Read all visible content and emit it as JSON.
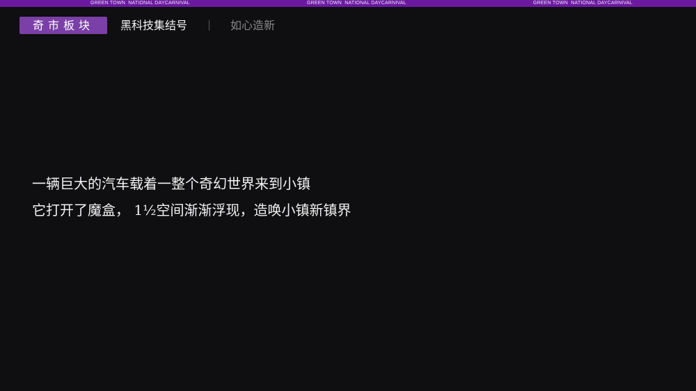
{
  "banner": {
    "texts": [
      "GREEN TOWN  NATIONAL DAYCARNIVAL",
      "GREEN TOWN  NATIONAL DAYCARNIVAL",
      "GREEN TOWN  NATIONAL DAYCARNIVAL"
    ],
    "color": "#6b1aa0"
  },
  "nav": {
    "tabs": [
      {
        "label": "奇市板块",
        "active": true
      },
      {
        "label": "黑科技集结号",
        "active": false
      },
      {
        "label": "如心造新",
        "active": false
      }
    ],
    "accent_color": "#7b3fa8"
  },
  "content": {
    "lines": [
      "一辆巨大的汽车载着一整个奇幻世界来到小镇",
      "它打开了魔盒， 1½空间渐渐浮现，造唤小镇新镇界"
    ]
  }
}
